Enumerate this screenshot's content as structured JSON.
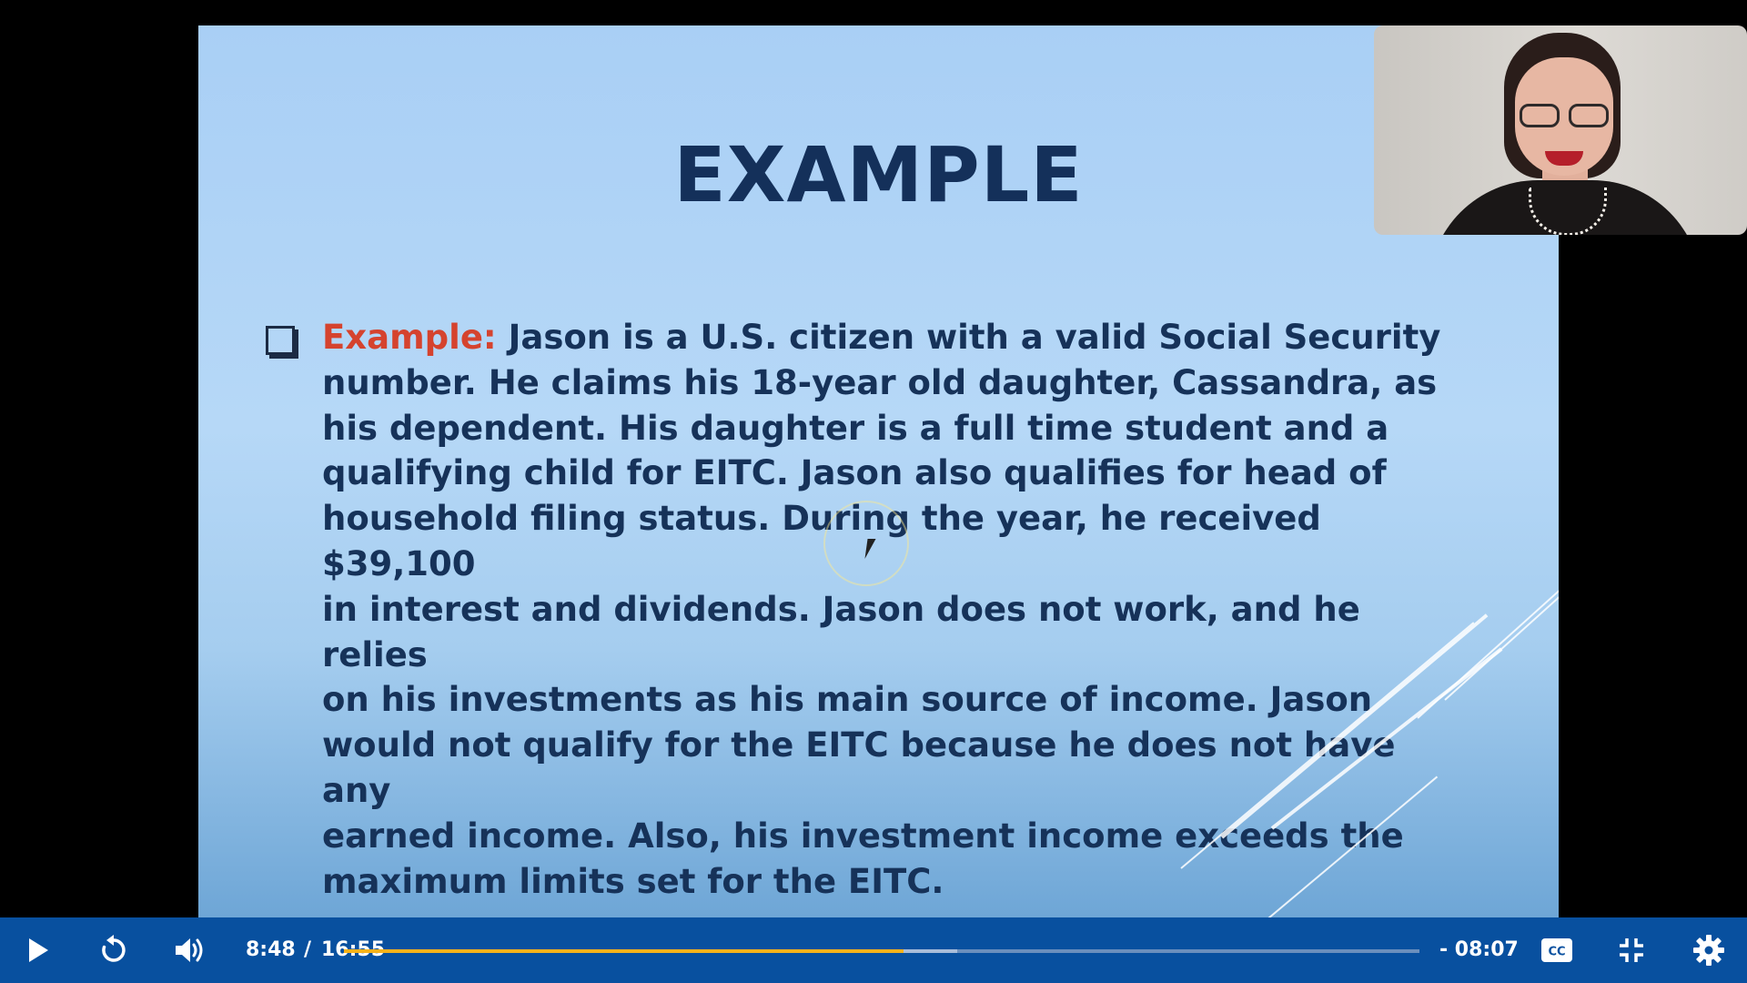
{
  "slide": {
    "title": "EXAMPLE",
    "example_label": "Example:",
    "body_lines": [
      "Jason is a U.S. citizen with a valid Social Security",
      "number. He claims his 18-year old daughter, Cassandra, as",
      "his dependent. His daughter is a full time student and a",
      "qualifying child for EITC. Jason also qualifies for head of",
      "household filing status. During the year, he received $39,100",
      "in interest and dividends. Jason does not work, and he relies",
      "on his investments as his main source of income. Jason",
      "would not qualify for the EITC because he does not have any",
      "earned income. Also, his investment income exceeds the",
      "maximum limits set for the EITC."
    ]
  },
  "player": {
    "current_time": "8:48",
    "separator": "/",
    "duration": "16:55",
    "remaining": "- 08:07",
    "progress_played": 0.52,
    "progress_buffered": 0.57,
    "icons": {
      "play": "play-icon",
      "replay": "replay-icon",
      "volume": "volume-icon",
      "captions": "closed-captions-icon",
      "exit_fullscreen": "exit-fullscreen-icon",
      "settings": "gear-icon"
    },
    "colors": {
      "bar": "#08509f",
      "progress": "#f6b21a"
    }
  }
}
